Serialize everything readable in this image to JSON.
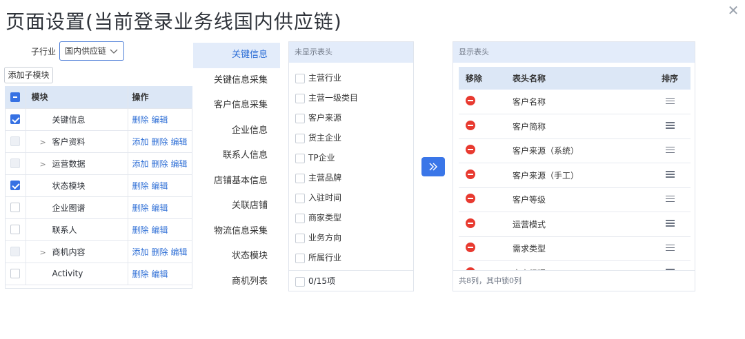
{
  "title": "页面设置(当前登录业务线国内供应链)",
  "sub_industry": {
    "label": "子行业",
    "selected": "国内供应链"
  },
  "add_sub_module": "添加子模块",
  "module_table": {
    "headers": {
      "module": "模块",
      "action": "操作"
    },
    "actions": {
      "add": "添加",
      "delete": "删除",
      "edit": "编辑"
    },
    "rows": [
      {
        "name": "关键信息",
        "expandable": false,
        "checked": true
      },
      {
        "name": "客户资料",
        "expandable": true,
        "checked": false
      },
      {
        "name": "运营数据",
        "expandable": true,
        "checked": false
      },
      {
        "name": "状态模块",
        "expandable": false,
        "checked": true
      },
      {
        "name": "企业图谱",
        "expandable": false,
        "checked": false
      },
      {
        "name": "联系人",
        "expandable": false,
        "checked": false
      },
      {
        "name": "商机内容",
        "expandable": true,
        "checked": false
      },
      {
        "name": "Activity",
        "expandable": false,
        "checked": false
      }
    ]
  },
  "categories": [
    "关键信息",
    "关键信息采集",
    "客户信息采集",
    "企业信息",
    "联系人信息",
    "店铺基本信息",
    "关联店铺",
    "物流信息采集",
    "状态模块",
    "商机列表"
  ],
  "hidden_panel": {
    "title": "未显示表头",
    "items": [
      "主营行业",
      "主营一级类目",
      "客户来源",
      "货主企业",
      "TP企业",
      "主营品牌",
      "入驻时间",
      "商家类型",
      "业务方向",
      "所属行业"
    ],
    "footer": "0/15项"
  },
  "transfer_icon": "double-chevron-right-icon",
  "shown_panel": {
    "title": "显示表头",
    "headers": {
      "remove": "移除",
      "name": "表头名称",
      "sort": "排序"
    },
    "rows": [
      "客户名称",
      "客户简称",
      "客户来源（系统）",
      "客户来源（手工）",
      "客户等级",
      "运营模式",
      "需求类型",
      "客户经理"
    ],
    "footer": "共8列，其中锁0列"
  },
  "colors": {
    "primary": "#3a76e8",
    "header_bg": "#dce7f6",
    "danger": "#e83a30"
  }
}
